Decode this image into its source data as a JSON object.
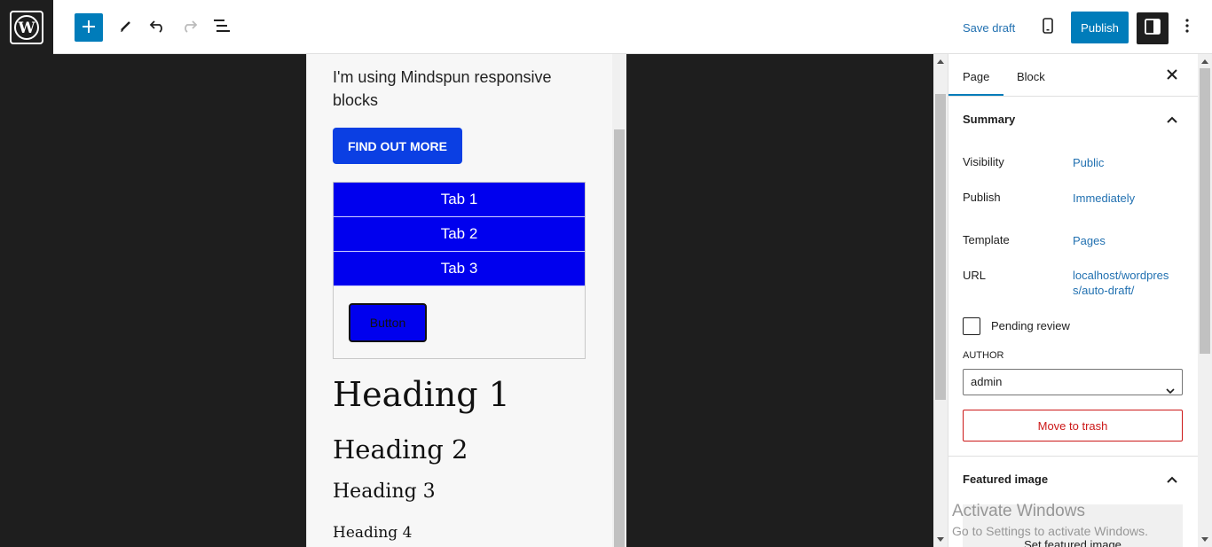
{
  "topbar": {
    "save_draft": "Save draft",
    "publish": "Publish",
    "accent_color": "#007cba"
  },
  "icons": [
    "wordpress-logo-icon",
    "plus-icon",
    "pencil-icon",
    "undo-icon",
    "redo-icon",
    "list-view-icon",
    "mobile-preview-icon",
    "settings-icon",
    "more-vertical-icon",
    "close-icon",
    "chevron-up-icon",
    "chevron-down-icon"
  ],
  "content": {
    "intro": "I'm using Mindspun responsive blocks",
    "cta": "FIND OUT MORE",
    "tabs": [
      "Tab 1",
      "Tab 2",
      "Tab 3"
    ],
    "tab_button": "Button",
    "headings": [
      "Heading 1",
      "Heading 2",
      "Heading 3",
      "Heading 4"
    ]
  },
  "sidebar": {
    "tabs": [
      "Page",
      "Block"
    ],
    "summary_title": "Summary",
    "rows": [
      {
        "label": "Visibility",
        "value": "Public"
      },
      {
        "label": "Publish",
        "value": "Immediately"
      },
      {
        "label": "Template",
        "value": "Pages"
      },
      {
        "label": "URL",
        "value": "localhost/wordpress/auto-draft/"
      }
    ],
    "pending_review": "Pending review",
    "author_label": "AUTHOR",
    "author_value": "admin",
    "move_to_trash": "Move to trash",
    "featured_image_title": "Featured image",
    "set_featured_image": "Set featured image"
  },
  "watermark": {
    "line1": "Activate Windows",
    "line2": "Go to Settings to activate Windows."
  }
}
